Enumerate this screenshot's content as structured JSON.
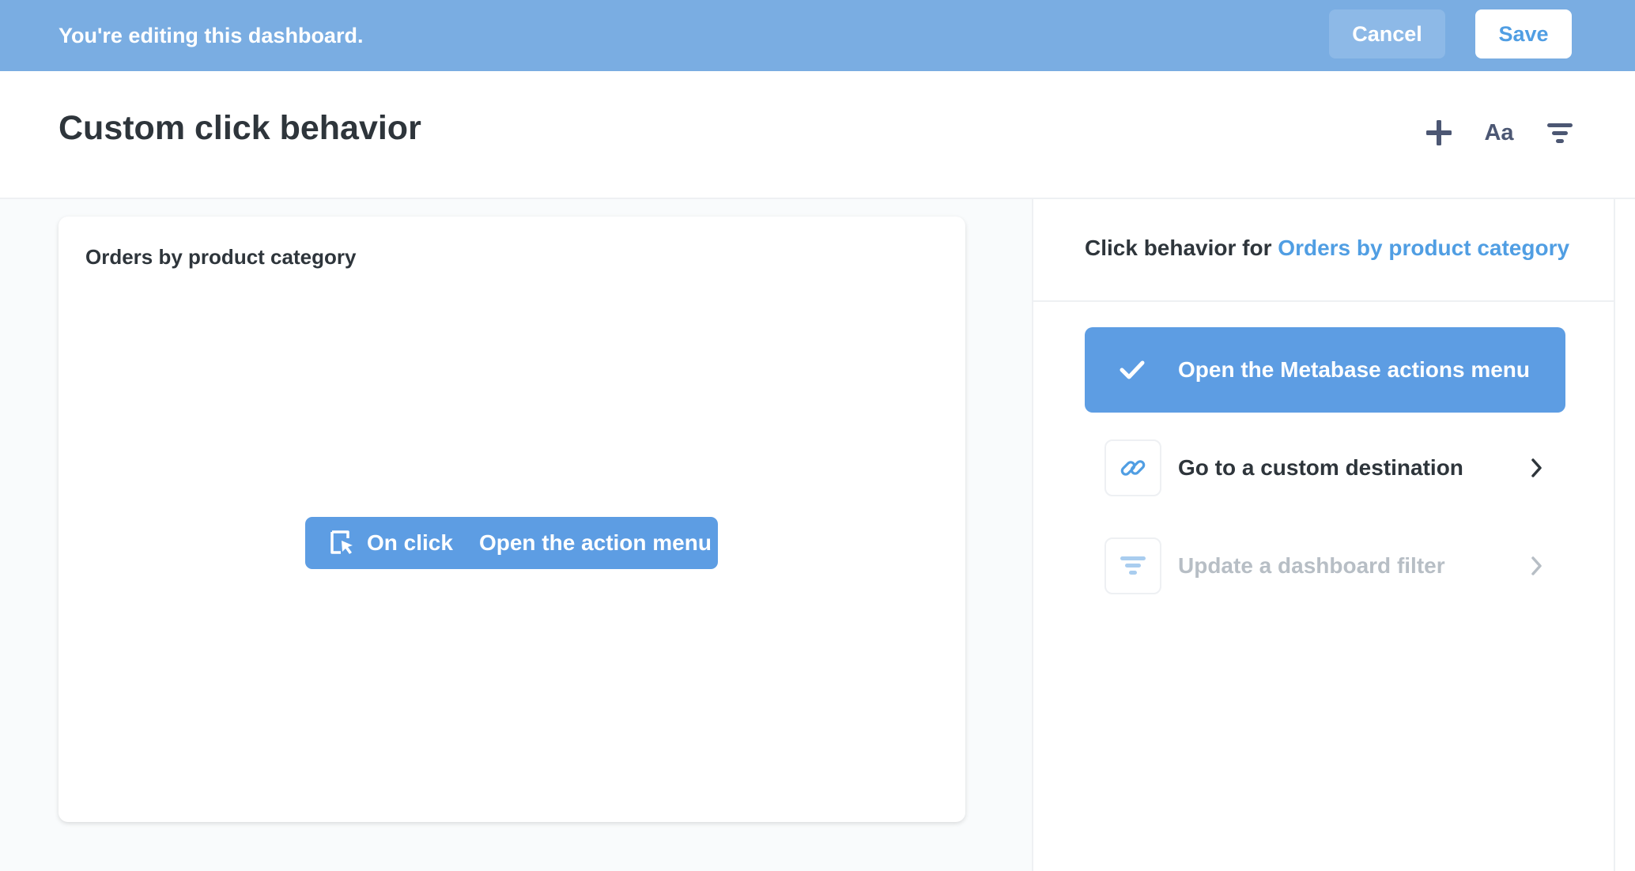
{
  "edit_bar": {
    "message": "You're editing this dashboard.",
    "cancel_label": "Cancel",
    "save_label": "Save"
  },
  "header": {
    "title": "Custom click behavior",
    "icons": [
      "plus-icon",
      "text-card-icon",
      "filter-icon"
    ],
    "text_icon_label": "Aa"
  },
  "card": {
    "title": "Orders by product category",
    "click_pill": {
      "icon": "cursor-click-icon",
      "on_label": "On click",
      "action_label": "Open the action menu"
    }
  },
  "sidebar": {
    "heading_prefix": "Click behavior for",
    "heading_link": "Orders by product category",
    "options": [
      {
        "label": "Open the Metabase actions menu",
        "icon": "check-icon",
        "selected": true
      },
      {
        "label": "Go to a custom destination",
        "icon": "link-icon",
        "selected": false
      },
      {
        "label": "Update a dashboard filter",
        "icon": "filter-icon",
        "selected": false,
        "disabled": true
      }
    ]
  },
  "colors": {
    "brand": "#509ee3",
    "edit_bar": "#7aade2",
    "selected_option": "#5d9de3",
    "text_dark": "#2e353b",
    "text_disabled": "#b7bec5"
  }
}
